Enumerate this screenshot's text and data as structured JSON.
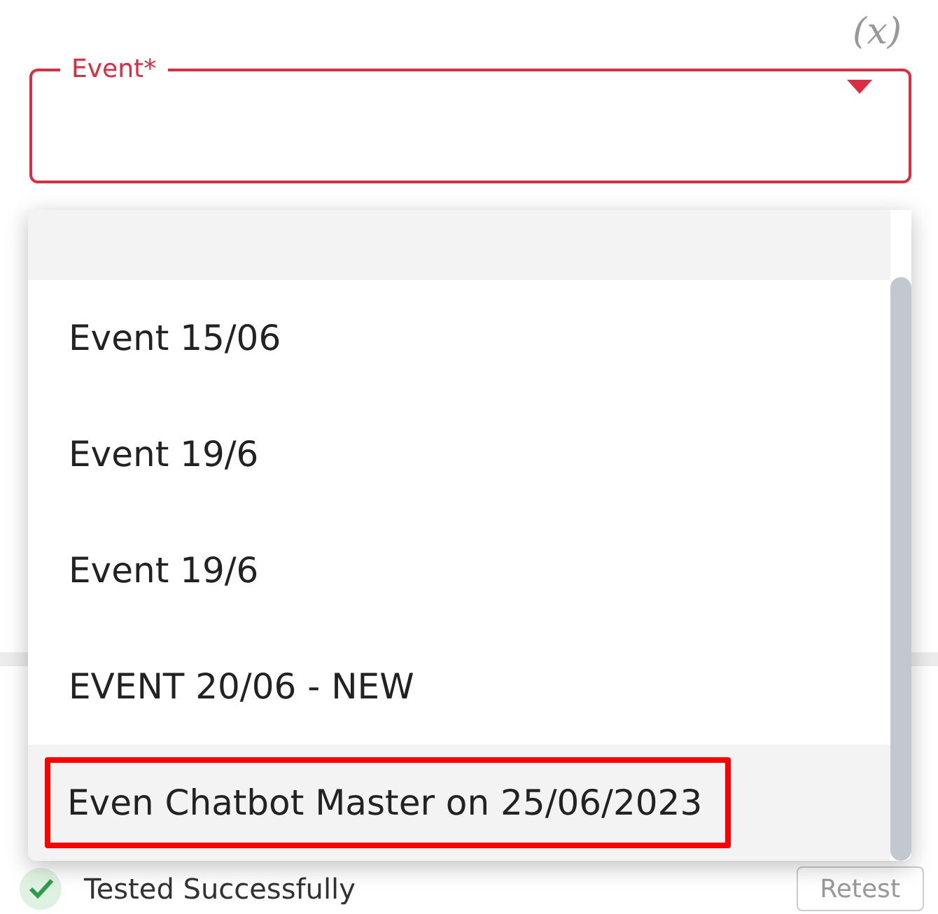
{
  "variable_button": {
    "label": "(x)"
  },
  "event_field": {
    "label": "Event*",
    "required": true,
    "open": true
  },
  "dropdown": {
    "options": [
      {
        "highlighted": true,
        "annotated": false
      },
      {
        "label": "Event 15/06",
        "highlighted": false,
        "annotated": false
      },
      {
        "label": "Event 19/6",
        "highlighted": false,
        "annotated": false
      },
      {
        "label": "Event 19/6",
        "highlighted": false,
        "annotated": false
      },
      {
        "label": "EVENT 20/06 - NEW",
        "highlighted": false,
        "annotated": false
      },
      {
        "label": "Even Chatbot Master on 25/06/2023",
        "highlighted": true,
        "annotated": true
      }
    ]
  },
  "background_section": {
    "status": {
      "text": "Tested Successfully",
      "ok": true
    },
    "button": "Retest"
  }
}
